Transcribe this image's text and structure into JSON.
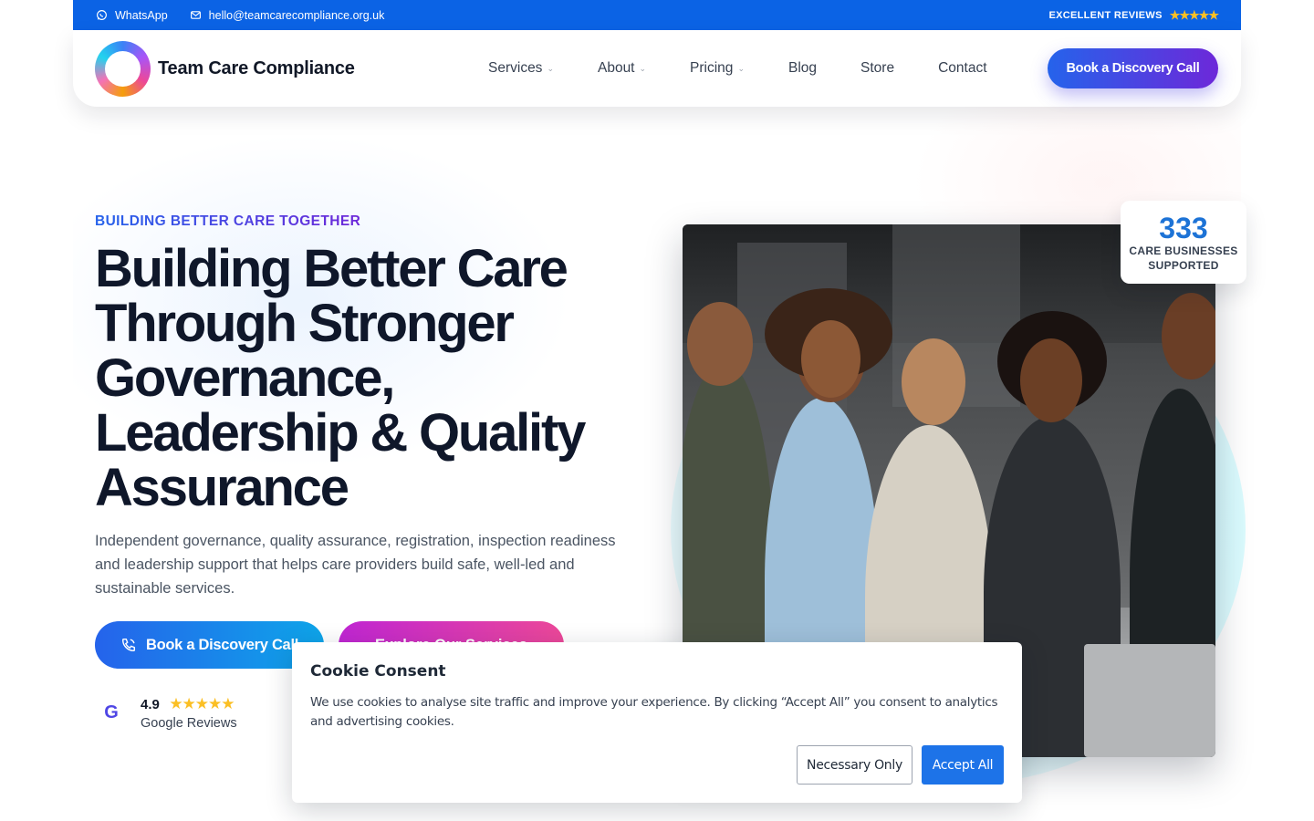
{
  "topbar": {
    "whatsapp": "WhatsApp",
    "email": "hello@teamcarecompliance.org.uk",
    "reviews_label": "EXCELLENT REVIEWS",
    "reviews_stars": "★★★★★"
  },
  "header": {
    "brand": "Team Care Compliance",
    "nav": [
      {
        "label": "Services",
        "has_dropdown": true
      },
      {
        "label": "About",
        "has_dropdown": true
      },
      {
        "label": "Pricing",
        "has_dropdown": true
      },
      {
        "label": "Blog",
        "has_dropdown": false
      },
      {
        "label": "Store",
        "has_dropdown": false
      },
      {
        "label": "Contact",
        "has_dropdown": false
      }
    ],
    "cta": "Book a Discovery Call"
  },
  "hero": {
    "eyebrow": "BUILDING BETTER CARE TOGETHER",
    "title": "Building Better Care Through Stronger Governance, Leadership & Quality Assurance",
    "subtitle": "Independent governance, quality assurance, registration, inspection readiness and leadership support that helps care providers build safe, well-led and sustainable services.",
    "primary_button": "Book a Discovery Call",
    "secondary_button": "Explore Our Services",
    "rating": {
      "score": "4.9",
      "stars": "★★★★★",
      "label": "Google Reviews",
      "icon_letter": "G"
    }
  },
  "stat": {
    "number": "333",
    "label_line1": "CARE BUSINESSES",
    "label_line2": "SUPPORTED"
  },
  "cookie": {
    "title": "Cookie Consent",
    "text": "We use cookies to analyse site traffic and improve your experience. By clicking “Accept All” you consent to analytics and advertising cookies.",
    "necessary_button": "Necessary Only",
    "accept_button": "Accept All"
  },
  "colors": {
    "topbar_bg": "#0b63e5",
    "brand_gradient_start": "#2563eb",
    "brand_gradient_end": "#6d28d9",
    "stat_number": "#1d73d6",
    "accept_button": "#1d73e8"
  },
  "icons": {
    "whatsapp": "whatsapp-icon",
    "email": "mail-icon",
    "phone": "phone-icon",
    "google": "google-icon",
    "dropdown": "chevron-down-icon"
  }
}
